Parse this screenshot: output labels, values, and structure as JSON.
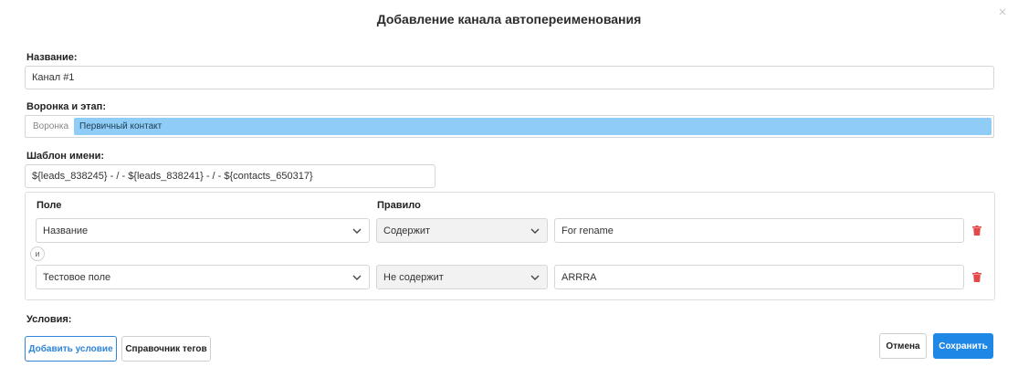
{
  "modal": {
    "title": "Добавление канала автопереименования",
    "close_label": "×"
  },
  "name_field": {
    "label": "Название:",
    "value": "Канал #1"
  },
  "funnel_field": {
    "label": "Воронка и этап:",
    "prefix": "Воронка",
    "value": "Первичный контакт"
  },
  "template_field": {
    "label": "Шаблон имени:",
    "value": "${leads_838245} - / - ${leads_838241} - / - ${contacts_650317}"
  },
  "conditions_table": {
    "header_field": "Поле",
    "header_rule": "Правило",
    "joiner": "и",
    "rows": [
      {
        "field": "Название",
        "rule": "Содержит",
        "value": "For rename"
      },
      {
        "field": "Тестовое поле",
        "rule": "Не содержит",
        "value": "ARRRA"
      }
    ]
  },
  "conditions_label": "Условия:",
  "buttons": {
    "add_condition": "Добавить условие",
    "tags_reference": "Справочник тегов",
    "cancel": "Отмена",
    "save": "Сохранить"
  },
  "colors": {
    "accent": "#1f87e5",
    "funnel_highlight": "#8fcdf6",
    "delete": "#e54848"
  }
}
